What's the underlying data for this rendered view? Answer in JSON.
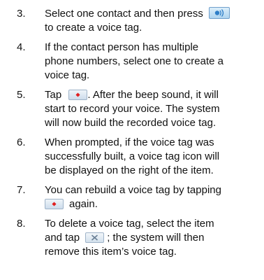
{
  "steps": [
    {
      "num": "3.",
      "lines": [
        "Select one contact and then press",
        "to create a voice tag."
      ]
    },
    {
      "num": "4.",
      "lines": [
        "If the contact person has multiple",
        "phone numbers, select one to create a",
        "voice tag."
      ]
    },
    {
      "num": "5.",
      "lines": [
        "Tap",
        ". After the beep sound, it will",
        "start to record your voice. The system",
        "will now build the recorded voice tag."
      ]
    },
    {
      "num": "6.",
      "lines": [
        "When prompted, if the voice tag was",
        "successfully built, a voice tag icon will",
        "be displayed on the right of the item."
      ]
    },
    {
      "num": "7.",
      "lines": [
        "You can rebuild a voice tag by tapping",
        "again."
      ]
    },
    {
      "num": "8.",
      "lines": [
        "To delete a voice tag, select the item",
        "and tap",
        "; the system will then",
        "remove this item’s voice tag."
      ]
    }
  ],
  "icons": {
    "voice_tag_button": "voice-tag-icon",
    "record_button": "record-icon",
    "delete_button": "delete-x-icon"
  },
  "colors": {
    "record_red": "#e02020",
    "voice_blue": "#2f7fc8"
  }
}
